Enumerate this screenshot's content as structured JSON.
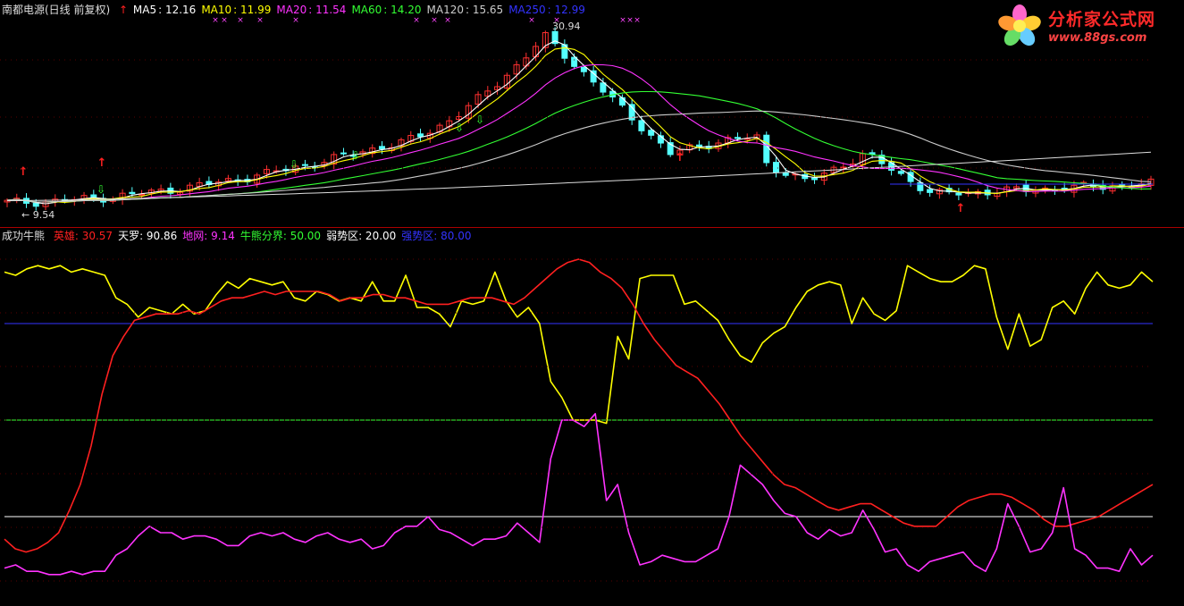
{
  "upper_header": {
    "stock": "南都电源(日线 前复权)",
    "items": [
      {
        "label": "MA5",
        "value": "12.16",
        "color": "#ffffff"
      },
      {
        "label": "MA10",
        "value": "11.99",
        "color": "#ffff00"
      },
      {
        "label": "MA20",
        "value": "11.54",
        "color": "#ff33ff"
      },
      {
        "label": "MA60",
        "value": "14.20",
        "color": "#33ff33"
      },
      {
        "label": "MA120",
        "value": "15.65",
        "color": "#cccccc"
      },
      {
        "label": "MA250",
        "value": "12.99",
        "color": "#3333ff"
      }
    ]
  },
  "lower_header": {
    "name": "成功牛熊",
    "items": [
      {
        "label": "英雄",
        "value": "30.57",
        "color": "#ff2020"
      },
      {
        "label": "天罗",
        "value": "90.86",
        "color": "#ffffff"
      },
      {
        "label": "地网",
        "value": "9.14",
        "color": "#ff33ff"
      },
      {
        "label": "牛熊分界",
        "value": "50.00",
        "color": "#33ff33"
      },
      {
        "label": "弱势区",
        "value": "20.00",
        "color": "#ffffff"
      },
      {
        "label": "强势区",
        "value": "80.00",
        "color": "#3333ff"
      }
    ]
  },
  "logo": {
    "text": "分析家公式网",
    "url": "www.88gs.com"
  },
  "chart_data": [
    {
      "type": "candlestick",
      "annotations": {
        "high_label": "30.94",
        "low_label": "9.54"
      },
      "ylim": [
        8.5,
        33
      ],
      "series": [
        {
          "name": "MA5",
          "color": "#ffffff"
        },
        {
          "name": "MA10",
          "color": "#ffff00"
        },
        {
          "name": "MA20",
          "color": "#ff33ff"
        },
        {
          "name": "MA60",
          "color": "#33ff33"
        },
        {
          "name": "MA120",
          "color": "#cccccc"
        },
        {
          "name": "MA250",
          "color": "#3333ff"
        }
      ]
    },
    {
      "type": "line",
      "ylim": [
        0,
        100
      ],
      "reference_lines": [
        {
          "value": 80,
          "color": "#3333ff"
        },
        {
          "value": 50,
          "color": "#33ff33"
        },
        {
          "value": 20,
          "color": "#ffffff"
        }
      ],
      "series": [
        {
          "name": "天罗",
          "color": "#ffff00",
          "values": [
            96,
            95,
            97,
            98,
            97,
            98,
            96,
            97,
            96,
            95,
            88,
            86,
            82,
            85,
            84,
            83,
            86,
            83,
            84,
            89,
            93,
            91,
            94,
            93,
            92,
            93,
            88,
            87,
            90,
            89,
            87,
            88,
            87,
            93,
            87,
            87,
            95,
            85,
            85,
            83,
            79,
            87,
            86,
            87,
            96,
            87,
            82,
            85,
            80,
            62,
            57,
            50,
            50,
            50,
            49,
            76,
            69,
            94,
            95,
            95,
            95,
            86,
            87,
            84,
            81,
            75,
            70,
            68,
            74,
            77,
            79,
            85,
            90,
            92,
            93,
            92,
            80,
            88,
            83,
            81,
            84,
            98,
            96,
            94,
            93,
            93,
            95,
            98,
            97,
            82,
            72,
            83,
            73,
            75,
            85,
            87,
            83,
            91,
            96,
            92,
            91,
            92,
            96,
            93
          ]
        },
        {
          "name": "英雄",
          "color": "#ff2020",
          "values": [
            13,
            10,
            9,
            10,
            12,
            15,
            22,
            30,
            42,
            58,
            70,
            76,
            81,
            82,
            83,
            83,
            83,
            84,
            83,
            85,
            87,
            88,
            88,
            89,
            90,
            89,
            90,
            90,
            90,
            90,
            89,
            87,
            88,
            88,
            89,
            89,
            88,
            88,
            87,
            86,
            86,
            86,
            87,
            88,
            88,
            88,
            87,
            86,
            88,
            91,
            94,
            97,
            99,
            100,
            99,
            96,
            94,
            91,
            86,
            80,
            75,
            71,
            67,
            65,
            63,
            59,
            55,
            50,
            45,
            41,
            37,
            33,
            30,
            29,
            27,
            25,
            23,
            22,
            23,
            24,
            24,
            22,
            20,
            18,
            17,
            17,
            17,
            20,
            23,
            25,
            26,
            27,
            27,
            26,
            24,
            22,
            19,
            17,
            17,
            18,
            19,
            20,
            22,
            24,
            26,
            28,
            30
          ]
        },
        {
          "name": "地网",
          "color": "#ff33ff",
          "values": [
            4,
            5,
            3,
            3,
            2,
            2,
            3,
            2,
            3,
            3,
            8,
            10,
            14,
            17,
            15,
            15,
            13,
            14,
            14,
            13,
            11,
            11,
            14,
            15,
            14,
            15,
            13,
            12,
            14,
            15,
            13,
            12,
            13,
            10,
            11,
            15,
            17,
            17,
            20,
            16,
            15,
            13,
            11,
            13,
            13,
            14,
            18,
            15,
            12,
            38,
            50,
            50,
            48,
            52,
            25,
            30,
            15,
            5,
            6,
            8,
            7,
            6,
            6,
            8,
            10,
            20,
            36,
            33,
            30,
            25,
            21,
            20,
            15,
            13,
            16,
            14,
            15,
            22,
            16,
            9,
            10,
            5,
            3,
            6,
            7,
            8,
            9,
            5,
            3,
            10,
            24,
            17,
            9,
            10,
            15,
            29,
            10,
            8,
            4,
            4,
            3,
            10,
            5,
            8
          ]
        }
      ]
    }
  ]
}
